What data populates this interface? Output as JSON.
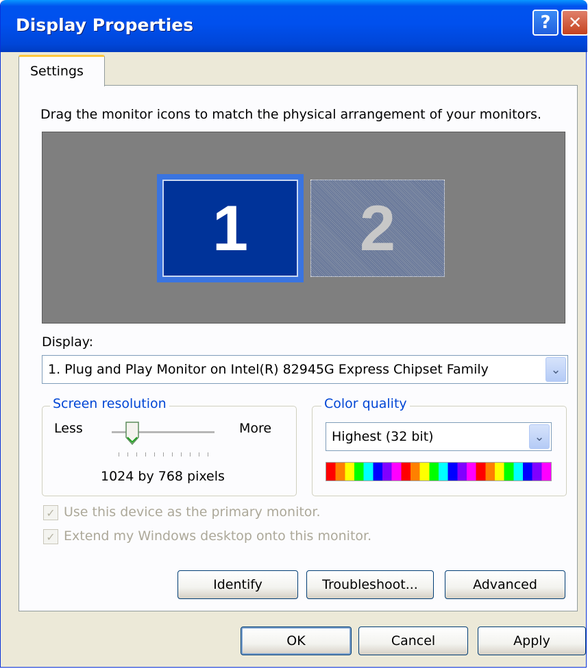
{
  "window": {
    "title": "Display Properties"
  },
  "titlebar": {
    "help_label": "?",
    "close_label": "✕"
  },
  "tabs": [
    {
      "label": "Settings"
    }
  ],
  "arrangement": {
    "instruction": "Drag the monitor icons to match the physical arrangement of your monitors.",
    "monitors": [
      {
        "number": "1"
      },
      {
        "number": "2"
      }
    ]
  },
  "display": {
    "label": "Display:",
    "selected": "1. Plug and Play Monitor on Intel(R) 82945G Express Chipset Family"
  },
  "screen_resolution": {
    "group_label": "Screen resolution",
    "less_label": "Less",
    "more_label": "More",
    "value_text": "1024 by 768 pixels",
    "slider_position": 0.2
  },
  "color_quality": {
    "group_label": "Color quality",
    "selected": "Highest (32 bit)",
    "spectrum_colors": [
      "#FF0000",
      "#FF8000",
      "#FFFF00",
      "#00FF00",
      "#00FFFF",
      "#0000FF",
      "#8000FF",
      "#FF00FF",
      "#FF0000",
      "#FF8000",
      "#FFFF00",
      "#00FF00",
      "#00FFFF",
      "#0000FF",
      "#8000FF",
      "#FF00FF",
      "#FF0000",
      "#FF8000",
      "#FFFF00",
      "#00FF00",
      "#00FFFF",
      "#0000FF",
      "#8000FF",
      "#FF00FF"
    ]
  },
  "checkboxes": [
    {
      "label": "Use this device as the primary monitor.",
      "checked": true,
      "enabled": false
    },
    {
      "label": "Extend my Windows desktop onto this monitor.",
      "checked": true,
      "enabled": false
    }
  ],
  "panel_buttons": {
    "identify": "Identify",
    "troubleshoot": "Troubleshoot...",
    "advanced": "Advanced"
  },
  "dialog_buttons": {
    "ok": "OK",
    "cancel": "Cancel",
    "apply": "Apply"
  },
  "icons": {
    "check": "✓",
    "dropdown_arrow": "⌄"
  },
  "colors": {
    "titlebar": "#0050EE",
    "window_bg": "#ECE9D8",
    "monitor_1": "#003399",
    "group_label": "#0046D5",
    "disabled_text": "#ACA899"
  }
}
